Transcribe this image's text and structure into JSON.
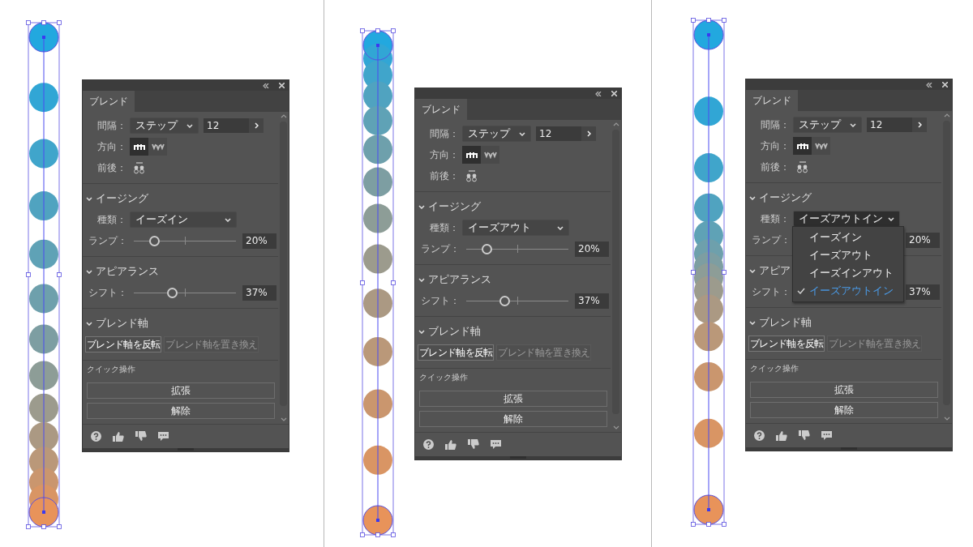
{
  "columns": [
    {
      "panel": {
        "tab": {
          "label": "ブレンド",
          "selected": true
        },
        "spacing": {
          "label": "間隔：",
          "mode": "ステップ",
          "value": "12"
        },
        "orientation": {
          "label": "方向：",
          "buttons": [
            {
              "kind": "page",
              "selected": true
            },
            {
              "kind": "path",
              "selected": false
            }
          ]
        },
        "order": {
          "label": "前後："
        },
        "easing": {
          "title": "イージング",
          "expanded": true,
          "kind": "ease-in",
          "type_label": "種類：",
          "type": "イーズイン",
          "ramp_label": "ランプ：",
          "ramp": {
            "level": 0.2,
            "reading": "20%"
          }
        },
        "appearance": {
          "title": "アピアランス",
          "expanded": true,
          "shift_label": "シフト：",
          "shift": {
            "level": 0.37,
            "reading": "37%"
          }
        },
        "blend_axis": {
          "title": "ブレンド軸",
          "expanded": true,
          "buttons": [
            {
              "label": "ブレンド軸を反転",
              "disabled": false
            },
            {
              "label": "ブレンド軸を置き換え",
              "disabled": true
            }
          ]
        },
        "quick_actions": {
          "title": "クイック操作",
          "buttons": [
            "拡張",
            "解除"
          ]
        }
      }
    },
    {
      "panel": {
        "tab": {
          "label": "ブレンド",
          "selected": true
        },
        "spacing": {
          "label": "間隔：",
          "mode": "ステップ",
          "value": "12"
        },
        "orientation": {
          "label": "方向：",
          "buttons": [
            {
              "kind": "page",
              "selected": true
            },
            {
              "kind": "path",
              "selected": false
            }
          ]
        },
        "order": {
          "label": "前後："
        },
        "easing": {
          "title": "イージング",
          "expanded": true,
          "kind": "ease-out",
          "type_label": "種類：",
          "type": "イーズアウト",
          "ramp_label": "ランプ：",
          "ramp": {
            "level": 0.2,
            "reading": "20%"
          }
        },
        "appearance": {
          "title": "アピアランス",
          "expanded": true,
          "shift_label": "シフト：",
          "shift": {
            "level": 0.37,
            "reading": "37%"
          }
        },
        "blend_axis": {
          "title": "ブレンド軸",
          "expanded": true,
          "buttons": [
            {
              "label": "ブレンド軸を反転",
              "disabled": false
            },
            {
              "label": "ブレンド軸を置き換え",
              "disabled": true
            }
          ]
        },
        "quick_actions": {
          "title": "クイック操作",
          "buttons": [
            "拡張",
            "解除"
          ]
        }
      }
    },
    {
      "panel": {
        "tab": {
          "label": "ブレンド",
          "selected": true
        },
        "spacing": {
          "label": "間隔：",
          "mode": "ステップ",
          "value": "12"
        },
        "orientation": {
          "label": "方向：",
          "buttons": [
            {
              "kind": "page",
              "selected": true
            },
            {
              "kind": "path",
              "selected": false
            }
          ]
        },
        "order": {
          "label": "前後："
        },
        "easing": {
          "title": "イージング",
          "expanded": true,
          "kind": "ease-out-in",
          "type_label": "種類：",
          "type": "イーズアウトイン",
          "ramp_label": "ランプ：",
          "ramp": {
            "reading": "20%"
          },
          "menu": [
            {
              "label": "イーズイン",
              "selected": false
            },
            {
              "label": "イーズアウト",
              "selected": false
            },
            {
              "label": "イーズインアウト",
              "selected": false
            },
            {
              "label": "イーズアウトイン",
              "selected": true
            }
          ]
        },
        "appearance": {
          "title": "アピア",
          "expanded": true,
          "shift_label": "シフト：",
          "shift": {
            "reading": "37%"
          }
        },
        "blend_axis": {
          "title": "ブレンド軸",
          "expanded": true,
          "buttons": [
            {
              "label": "ブレンド軸を反転",
              "disabled": false
            },
            {
              "label": "ブレンド軸を置き換え",
              "disabled": true
            }
          ]
        },
        "quick_actions": {
          "title": "クイック操作",
          "buttons": [
            "拡張",
            "解除"
          ]
        }
      }
    }
  ]
}
